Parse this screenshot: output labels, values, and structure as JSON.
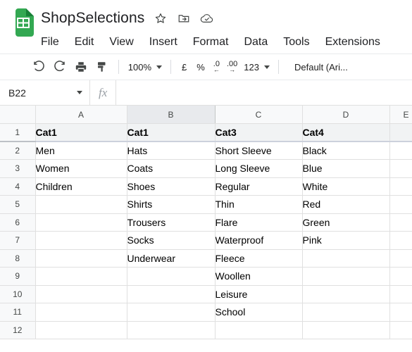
{
  "app": {
    "doc_icon": "sheets-doc-icon",
    "title": "ShopSelections",
    "title_icons": [
      {
        "name": "star-icon",
        "label": "Star"
      },
      {
        "name": "move-to-folder-icon",
        "label": "Move"
      },
      {
        "name": "cloud-saved-icon",
        "label": "Saved to Drive"
      }
    ],
    "menu": [
      {
        "label": "File"
      },
      {
        "label": "Edit"
      },
      {
        "label": "View"
      },
      {
        "label": "Insert"
      },
      {
        "label": "Format"
      },
      {
        "label": "Data"
      },
      {
        "label": "Tools"
      },
      {
        "label": "Extensions"
      }
    ]
  },
  "toolbar": {
    "undo_icon": "undo-icon",
    "redo_icon": "redo-icon",
    "print_icon": "print-icon",
    "paint_format_icon": "paint-format-icon",
    "zoom_value": "100%",
    "currency_label": "£",
    "percent_label": "%",
    "decrease_decimal_top": ".0",
    "decrease_decimal_bottom": "←",
    "increase_decimal_top": ".00",
    "increase_decimal_bottom": "→",
    "number_format_label": "123",
    "font_name": "Default (Ari..."
  },
  "formula_bar": {
    "name_box_value": "B22",
    "fx_label": "fx",
    "formula_value": "",
    "formula_placeholder": ""
  },
  "grid": {
    "columns": [
      "A",
      "B",
      "C",
      "D",
      "E"
    ],
    "selected_column": "B",
    "selected_cell": "B22",
    "rows": [
      "1",
      "2",
      "3",
      "4",
      "5",
      "6",
      "7",
      "8",
      "9",
      "10",
      "11",
      "12"
    ],
    "header_row_index": 0,
    "data": [
      [
        "Cat1",
        "Cat1",
        "Cat3",
        "Cat4",
        ""
      ],
      [
        "Men",
        "Hats",
        "Short Sleeve",
        "Black",
        ""
      ],
      [
        "Women",
        "Coats",
        "Long Sleeve",
        "Blue",
        ""
      ],
      [
        "Children",
        "Shoes",
        "Regular",
        "White",
        ""
      ],
      [
        "",
        "Shirts",
        "Thin",
        "Red",
        ""
      ],
      [
        "",
        "Trousers",
        "Flare",
        "Green",
        ""
      ],
      [
        "",
        "Socks",
        "Waterproof",
        "Pink",
        ""
      ],
      [
        "",
        "Underwear",
        "Fleece",
        "",
        ""
      ],
      [
        "",
        "",
        "Woollen",
        "",
        ""
      ],
      [
        "",
        "",
        "Leisure",
        "",
        ""
      ],
      [
        "",
        "",
        "School",
        "",
        ""
      ],
      [
        "",
        "",
        "",
        "",
        ""
      ]
    ]
  },
  "colors": {
    "brand_green": "#33a852",
    "header_cell_bg": "#f1f3f4",
    "col_header_bg": "#f8f9fa",
    "col_header_selected_bg": "#e8eaed",
    "grid_line": "#e0e0e0",
    "text": "#202124"
  }
}
